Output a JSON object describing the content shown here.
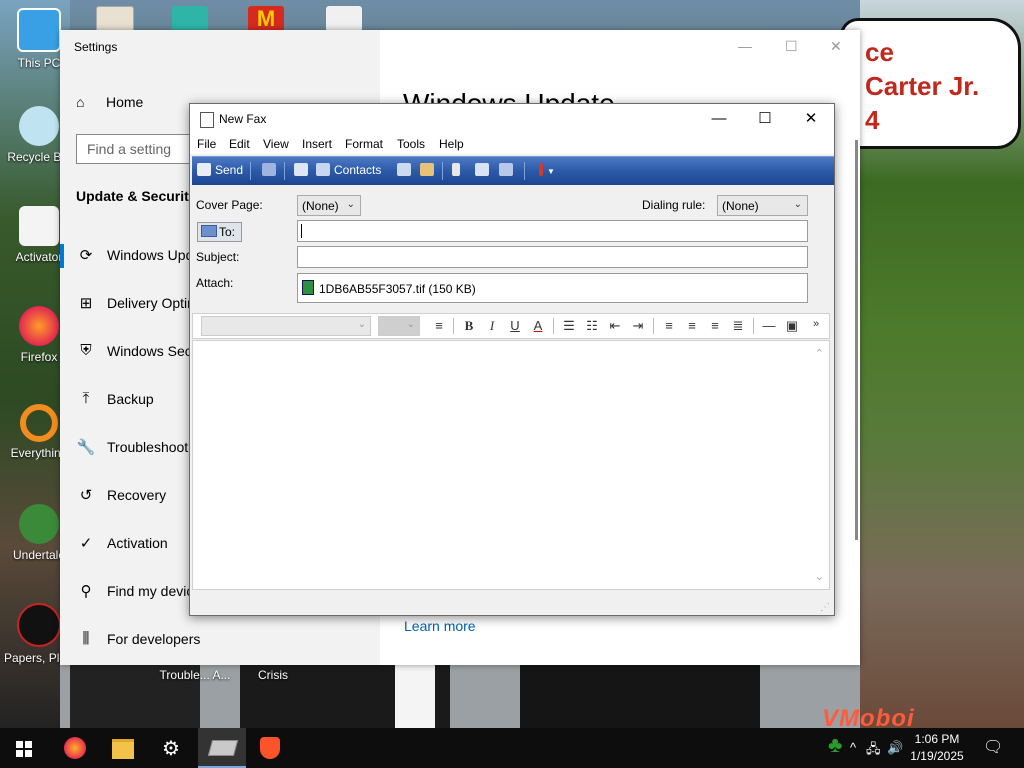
{
  "desktop": {
    "icons": [
      {
        "label": "This PC"
      },
      {
        "label": "Recycle Bin"
      },
      {
        "label": "Activator"
      },
      {
        "label": "Firefox"
      },
      {
        "label": "Everything"
      },
      {
        "label": "Undertale"
      },
      {
        "label": "Papers, Please"
      }
    ],
    "bottom_labels": [
      "Trouble... A...",
      "Crisis"
    ],
    "speech_text": "ce\nCarter Jr.\n4",
    "watermark": "VMoboi"
  },
  "settings": {
    "title": "Settings",
    "home": "Home",
    "search_placeholder": "Find a setting",
    "section": "Update & Security",
    "nav": [
      {
        "label": "Windows Update",
        "icon": "refresh-icon"
      },
      {
        "label": "Delivery Optimization",
        "icon": "delivery-icon"
      },
      {
        "label": "Windows Security",
        "icon": "shield-icon"
      },
      {
        "label": "Backup",
        "icon": "backup-icon"
      },
      {
        "label": "Troubleshoot",
        "icon": "wrench-icon"
      },
      {
        "label": "Recovery",
        "icon": "recovery-icon"
      },
      {
        "label": "Activation",
        "icon": "check-circle-icon"
      },
      {
        "label": "Find my device",
        "icon": "person-pin-icon"
      },
      {
        "label": "For developers",
        "icon": "sliders-icon"
      }
    ],
    "page_title": "Windows Update",
    "learn_more": "Learn more"
  },
  "fax": {
    "title": "New Fax",
    "menu": [
      "File",
      "Edit",
      "View",
      "Insert",
      "Format",
      "Tools",
      "Help"
    ],
    "toolbar": {
      "send": "Send",
      "contacts": "Contacts"
    },
    "cover_page_label": "Cover Page:",
    "cover_page_value": "(None)",
    "dialing_rule_label": "Dialing rule:",
    "dialing_rule_value": "(None)",
    "to_label": "To:",
    "subject_label": "Subject:",
    "attach_label": "Attach:",
    "attachment": "1DB6AB55F3057.tif (150 KB)",
    "format_more": "»"
  },
  "taskbar": {
    "time": "1:06 PM",
    "date": "1/19/2025"
  }
}
